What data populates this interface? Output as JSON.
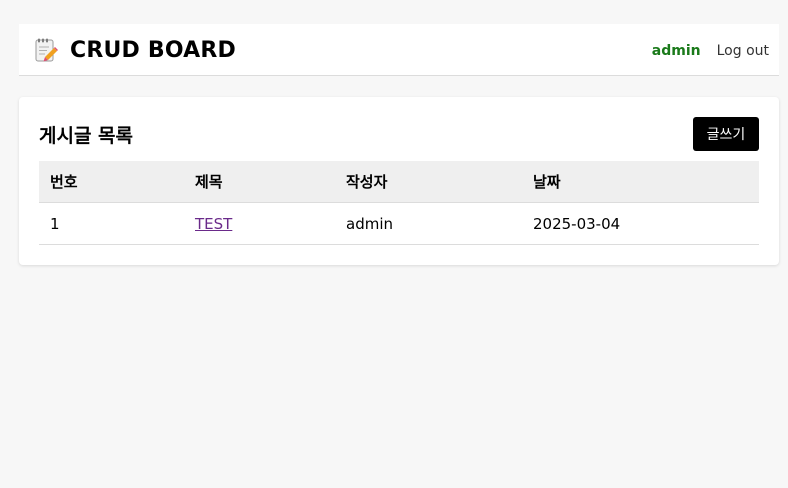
{
  "header": {
    "brand_title": "CRUD BOARD",
    "brand_icon": "memo-icon",
    "user_name": "admin",
    "logout_label": "Log out"
  },
  "board": {
    "title": "게시글 목록",
    "write_label": "글쓰기",
    "columns": [
      "번호",
      "제목",
      "작성자",
      "날짜"
    ],
    "rows": [
      {
        "no": "1",
        "title": "TEST",
        "author": "admin",
        "date": "2025-03-04"
      }
    ]
  },
  "colors": {
    "background": "#f7f7f7",
    "user_name": "#1a7a1a",
    "link_visited": "#6a2a8a",
    "button_bg": "#000000"
  }
}
